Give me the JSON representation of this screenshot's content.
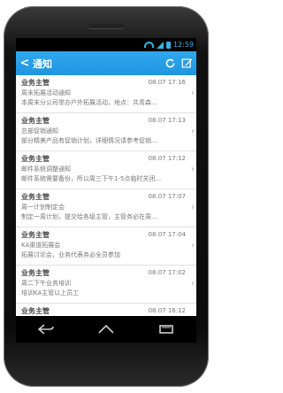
{
  "status": {
    "time": "12:59"
  },
  "header": {
    "title": "通知",
    "back_icon": "back-icon",
    "refresh_icon": "refresh-icon",
    "compose_icon": "compose-icon"
  },
  "notifications": [
    {
      "sender": "业务主管",
      "time": "08.07 17:16",
      "subject": "周末拓展活动通知",
      "preview": "本周末分公司举办户外拓展活动，地点：共青森..."
    },
    {
      "sender": "业务主管",
      "time": "08.07 17:13",
      "subject": "总部促销通知",
      "preview": "部分精美产品有促销计划，详细情况请参考促销..."
    },
    {
      "sender": "业务主管",
      "time": "08.07 17:12",
      "subject": "邮件系统调整通知",
      "preview": "邮件系统需要备份，所以周三下午1-5点临时关闭..."
    },
    {
      "sender": "业务主管",
      "time": "08.07 17:07",
      "subject": "周一计划制定会",
      "preview": "制定一周计划，提交给各级主管，主管务必在周..."
    },
    {
      "sender": "业务主管",
      "time": "08.07 17:04",
      "subject": "KA渠道拓展会",
      "preview": "拓展讨论会，业务代表务必全员参加"
    },
    {
      "sender": "业务主管",
      "time": "08.07 17:02",
      "subject": "周二下午业务培训",
      "preview": "培训KA主管以上员工"
    },
    {
      "sender": "业务主管",
      "time": "08.07 16:12",
      "subject": "",
      "preview": ""
    }
  ],
  "colors": {
    "accent": "#1f95e0",
    "status_icon": "#38b0e0"
  }
}
